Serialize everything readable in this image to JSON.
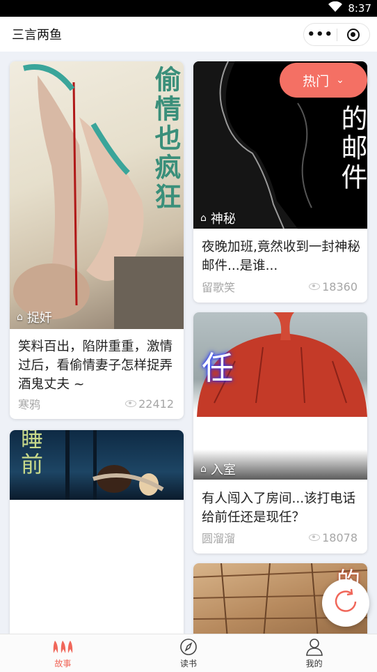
{
  "status_bar": {
    "time": "8:37"
  },
  "header": {
    "title": "三言两鱼",
    "more_label": "•••"
  },
  "hot_button": {
    "label": "热门"
  },
  "cards": [
    {
      "tag": "捉奸",
      "cover_text": "偷情也疯狂",
      "title": "笑料百出，陷阱重重，激情过后，看偷情妻子怎样捉弄酒鬼丈夫 ~",
      "author": "寒鸦",
      "views": "22412"
    },
    {
      "tag": "神秘",
      "cover_text": "的邮件",
      "title": "夜晚加班,竟然收到一封神秘邮件...是谁...",
      "author": "留歌笑",
      "views": "18360"
    },
    {
      "cover_text": "睡前"
    },
    {
      "tag": "入室",
      "cover_text": "任",
      "title": "有人闯入了房间...该打电话给前任还是现任？",
      "author": "圆溜溜",
      "views": "18078"
    },
    {
      "cover_text": "的"
    }
  ],
  "tabbar": {
    "items": [
      {
        "label": "故事"
      },
      {
        "label": "读书"
      },
      {
        "label": "我的"
      }
    ]
  },
  "colors": {
    "accent": "#f0675a",
    "hot_button": "#f47064"
  }
}
